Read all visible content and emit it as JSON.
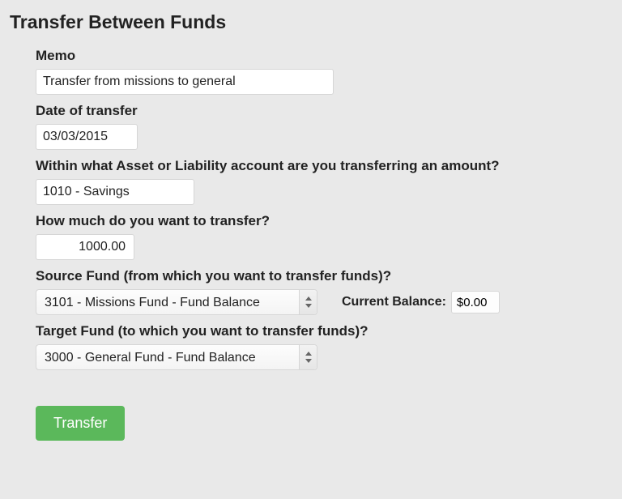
{
  "page": {
    "title": "Transfer Between Funds"
  },
  "labels": {
    "memo": "Memo",
    "date": "Date of transfer",
    "account": "Within what Asset or Liability account are you transferring an amount?",
    "amount": "How much do you want to transfer?",
    "source_fund": "Source Fund (from which you want to transfer funds)?",
    "target_fund": "Target Fund (to which you want to transfer funds)?",
    "current_balance": "Current Balance:"
  },
  "values": {
    "memo": "Transfer from missions to general",
    "date": "03/03/2015",
    "account": "1010 - Savings",
    "amount": "1000.00",
    "source_fund": "3101 - Missions Fund - Fund Balance",
    "target_fund": "3000 - General Fund - Fund Balance",
    "current_balance": "$0.00"
  },
  "button": {
    "transfer": "Transfer"
  }
}
